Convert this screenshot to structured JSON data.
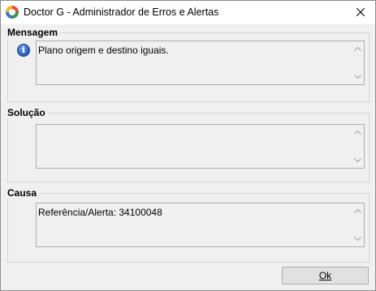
{
  "window": {
    "title": "Doctor G - Administrador de Erros e Alertas",
    "icon": "app-logo-icon",
    "close_icon": "close-icon"
  },
  "sections": {
    "mensagem": {
      "label": "Mensagem",
      "text": "Plano origem e destino iguais.",
      "icon": "info-icon",
      "icon_glyph": "i"
    },
    "solucao": {
      "label": "Solução",
      "text": ""
    },
    "causa": {
      "label": "Causa",
      "text": "Referência/Alerta: 34100048"
    }
  },
  "buttons": {
    "ok_label": "Ok"
  },
  "colors": {
    "info_blue": "#2f65c6",
    "border": "#adadad",
    "background": "#f0f0f0"
  }
}
